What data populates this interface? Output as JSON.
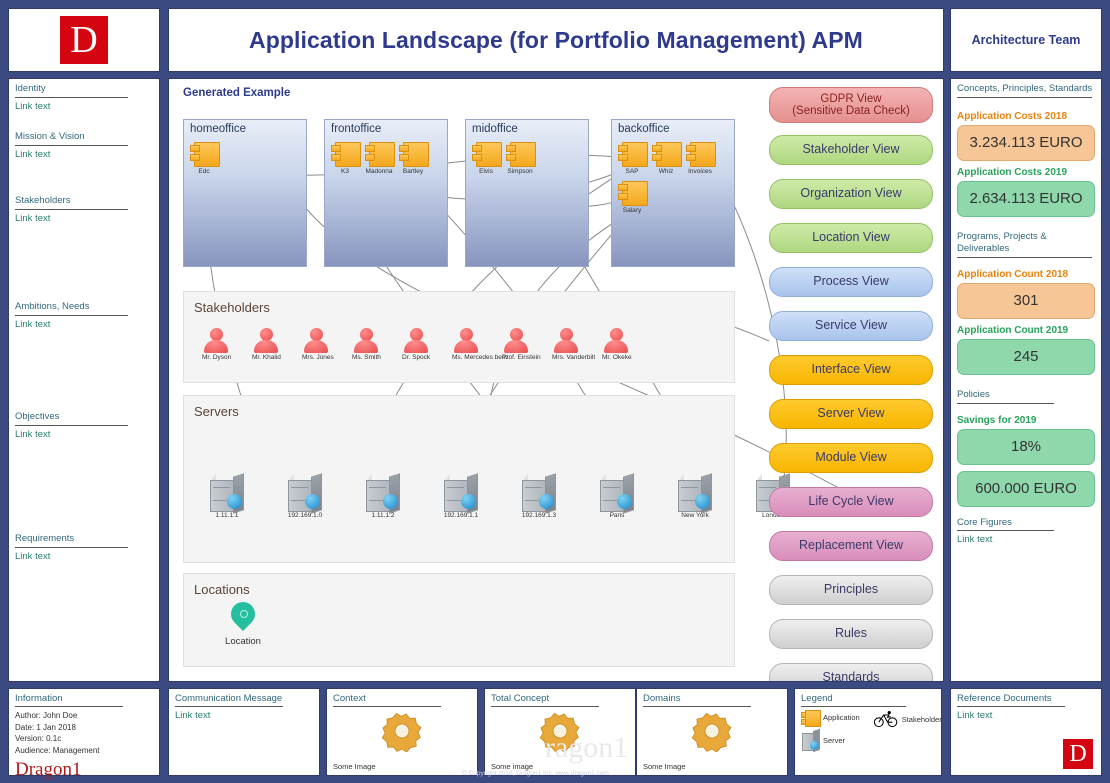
{
  "header": {
    "logo_letter": "D",
    "title": "Application Landscape (for Portfolio Management) APM",
    "team": "Architecture Team"
  },
  "left_sidebar": {
    "sections": [
      {
        "heading": "Identity",
        "link": "Link text"
      },
      {
        "heading": "Mission & Vision",
        "link": "Link text"
      },
      {
        "heading": "Stakeholders",
        "link": "Link text"
      },
      {
        "heading": "Ambitions, Needs",
        "link": "Link text"
      },
      {
        "heading": "Objectives",
        "link": "Link text"
      },
      {
        "heading": "Requirements",
        "link": "Link text"
      }
    ]
  },
  "right_sidebar": {
    "sections": [
      {
        "heading": "Concepts, Principles, Standards"
      },
      {
        "heading": "Programs, Projects & Deliverables"
      },
      {
        "heading": "Policies"
      },
      {
        "heading": "Core Figures",
        "link": "Link text"
      }
    ],
    "metrics": [
      {
        "label": "Application Costs 2018",
        "value": "3.234.113 EURO",
        "color": "orange"
      },
      {
        "label": "Application Costs 2019",
        "value": "2.634.113 EURO",
        "color": "green"
      },
      {
        "label": "Application Count 2018",
        "value": "301",
        "color": "orange"
      },
      {
        "label": "Application Count 2019",
        "value": "245",
        "color": "green"
      },
      {
        "label": "Savings for 2019",
        "value": "18%",
        "color": "green"
      },
      {
        "label": "",
        "value": "600.000 EURO",
        "color": "green"
      }
    ]
  },
  "canvas": {
    "generated_label": "Generated Example",
    "zones": [
      {
        "name": "homeoffice",
        "apps": [
          "Edc"
        ]
      },
      {
        "name": "frontoffice",
        "apps": [
          "K3",
          "Madonna",
          "Bartley"
        ]
      },
      {
        "name": "midoffice",
        "apps": [
          "Elvis",
          "Simpson"
        ]
      },
      {
        "name": "backoffice",
        "apps": [
          "SAP",
          "Whiz",
          "Invoices",
          "Salary"
        ]
      }
    ],
    "stakeholders_section": {
      "heading": "Stakeholders",
      "people": [
        "Mr. Dyson",
        "Mr. Khalid",
        "Mrs. Jones",
        "Ms. Smith",
        "Dr. Spock",
        "Ms. Mercedes benz",
        "Prof. Einstein",
        "Mrs. Vanderbilt",
        "Mr. Okeke"
      ]
    },
    "servers_section": {
      "heading": "Servers",
      "servers": [
        "1.11.1.1",
        "192.169.1.0",
        "1.11.1.2",
        "192.169.1.1",
        "192.169.1.3",
        "Paris",
        "New York",
        "London"
      ]
    },
    "locations_section": {
      "heading": "Locations",
      "locations": [
        "Location"
      ]
    }
  },
  "views": [
    {
      "label": "GDPR View\n(Sensitive Data Check)",
      "color": "v-red",
      "two_line": true
    },
    {
      "label": "Stakeholder View",
      "color": "v-green",
      "two_line": false
    },
    {
      "label": "Organization View",
      "color": "v-green",
      "two_line": false
    },
    {
      "label": "Location View",
      "color": "v-green",
      "two_line": false
    },
    {
      "label": "Process View",
      "color": "v-blue",
      "two_line": false
    },
    {
      "label": "Service View",
      "color": "v-blue",
      "two_line": false
    },
    {
      "label": "Interface View",
      "color": "v-orange",
      "two_line": false
    },
    {
      "label": "Server View",
      "color": "v-orange",
      "two_line": false
    },
    {
      "label": "Module View",
      "color": "v-orange",
      "two_line": false
    },
    {
      "label": "Life Cycle View",
      "color": "v-pink",
      "two_line": false
    },
    {
      "label": "Replacement View",
      "color": "v-pink",
      "two_line": false
    },
    {
      "label": "Principles",
      "color": "v-grey",
      "two_line": false
    },
    {
      "label": "Rules",
      "color": "v-grey",
      "two_line": false
    },
    {
      "label": "Standards",
      "color": "v-grey",
      "two_line": false
    }
  ],
  "footer": {
    "information": {
      "heading": "Information",
      "author": "Author: John Doe",
      "date": "Date: 1 Jan 2018",
      "version": "Version: 0.1c",
      "audience": "Audience: Management",
      "brand": "Dragon1"
    },
    "communication": {
      "heading": "Communication Message",
      "link": "Link text"
    },
    "context": {
      "heading": "Context",
      "caption": "Some Image"
    },
    "total_concept": {
      "heading": "Total Concept",
      "caption": "Some image"
    },
    "domains": {
      "heading": "Domains",
      "caption": "Some Image"
    },
    "legend": {
      "heading": "Legend",
      "items": [
        {
          "label": "Application",
          "icon": "application-icon"
        },
        {
          "label": "Stakeholder",
          "icon": "bicycle-icon"
        },
        {
          "label": "Server",
          "icon": "server-icon"
        }
      ]
    },
    "reference": {
      "heading": "Reference Documents",
      "link": "Link text",
      "logo_letter": "D"
    },
    "copyright": "© Copyright 2018, Dragon1 Inc. www.dragon1.com"
  }
}
